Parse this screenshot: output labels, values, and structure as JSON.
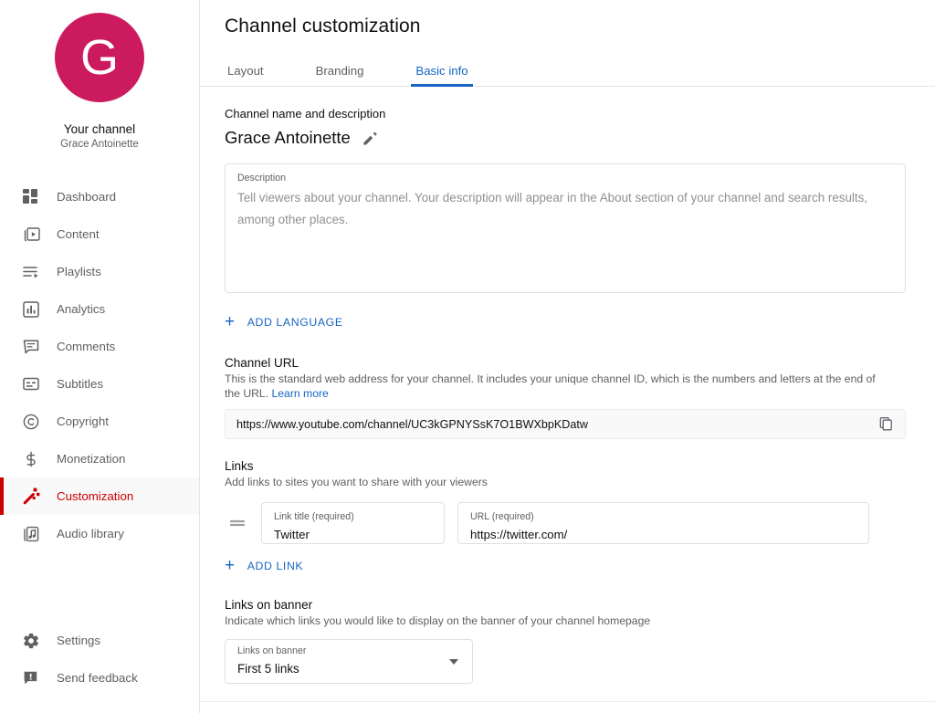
{
  "colors": {
    "avatar_bg": "#cc1a5e",
    "accent_blue": "#1565c0",
    "accent_red": "#cc0000",
    "text_primary": "#0f0f0f",
    "text_secondary": "#606060"
  },
  "sidebar": {
    "avatar_initial": "G",
    "your_channel_label": "Your channel",
    "channel_name": "Grace Antoinette",
    "items": [
      {
        "label": "Dashboard",
        "icon": "dashboard-icon",
        "active": false
      },
      {
        "label": "Content",
        "icon": "content-icon",
        "active": false
      },
      {
        "label": "Playlists",
        "icon": "playlists-icon",
        "active": false
      },
      {
        "label": "Analytics",
        "icon": "analytics-icon",
        "active": false
      },
      {
        "label": "Comments",
        "icon": "comments-icon",
        "active": false
      },
      {
        "label": "Subtitles",
        "icon": "subtitles-icon",
        "active": false
      },
      {
        "label": "Copyright",
        "icon": "copyright-icon",
        "active": false
      },
      {
        "label": "Monetization",
        "icon": "dollar-icon",
        "active": false
      },
      {
        "label": "Customization",
        "icon": "magic-wand-icon",
        "active": true
      },
      {
        "label": "Audio library",
        "icon": "audio-library-icon",
        "active": false
      }
    ],
    "bottom_items": [
      {
        "label": "Settings",
        "icon": "gear-icon"
      },
      {
        "label": "Send feedback",
        "icon": "feedback-icon"
      }
    ]
  },
  "header": {
    "title": "Channel customization",
    "tabs": [
      {
        "label": "Layout",
        "active": false
      },
      {
        "label": "Branding",
        "active": false
      },
      {
        "label": "Basic info",
        "active": true
      }
    ]
  },
  "basic_info": {
    "name_section": {
      "label": "Channel name and description",
      "channel_name": "Grace Antoinette",
      "edit_icon": "pencil-icon"
    },
    "description": {
      "field_label": "Description",
      "value": "",
      "placeholder": "Tell viewers about your channel. Your description will appear in the About section of your channel and search results, among other places."
    },
    "add_language_button": {
      "label": "ADD LANGUAGE",
      "icon": "plus-icon"
    },
    "channel_url": {
      "heading": "Channel URL",
      "description": "This is the standard web address for your channel. It includes your unique channel ID, which is the numbers and letters at the end of the URL.",
      "learn_more": "Learn more",
      "value": "https://www.youtube.com/channel/UC3kGPNYSsK7O1BWXbpKDatw",
      "copy_icon": "copy-icon"
    },
    "links": {
      "heading": "Links",
      "description": "Add links to sites you want to share with your viewers",
      "drag_handle_icon": "drag-handle-icon",
      "rows": [
        {
          "title_label": "Link title (required)",
          "title_value": "Twitter",
          "url_label": "URL (required)",
          "url_value": "https://twitter.com/"
        }
      ],
      "add_link_button": {
        "label": "ADD LINK",
        "icon": "plus-icon"
      }
    },
    "links_on_banner": {
      "heading": "Links on banner",
      "description": "Indicate which links you would like to display on the banner of your channel homepage",
      "field_label": "Links on banner",
      "selected": "First 5 links",
      "caret_icon": "chevron-down-icon"
    }
  }
}
